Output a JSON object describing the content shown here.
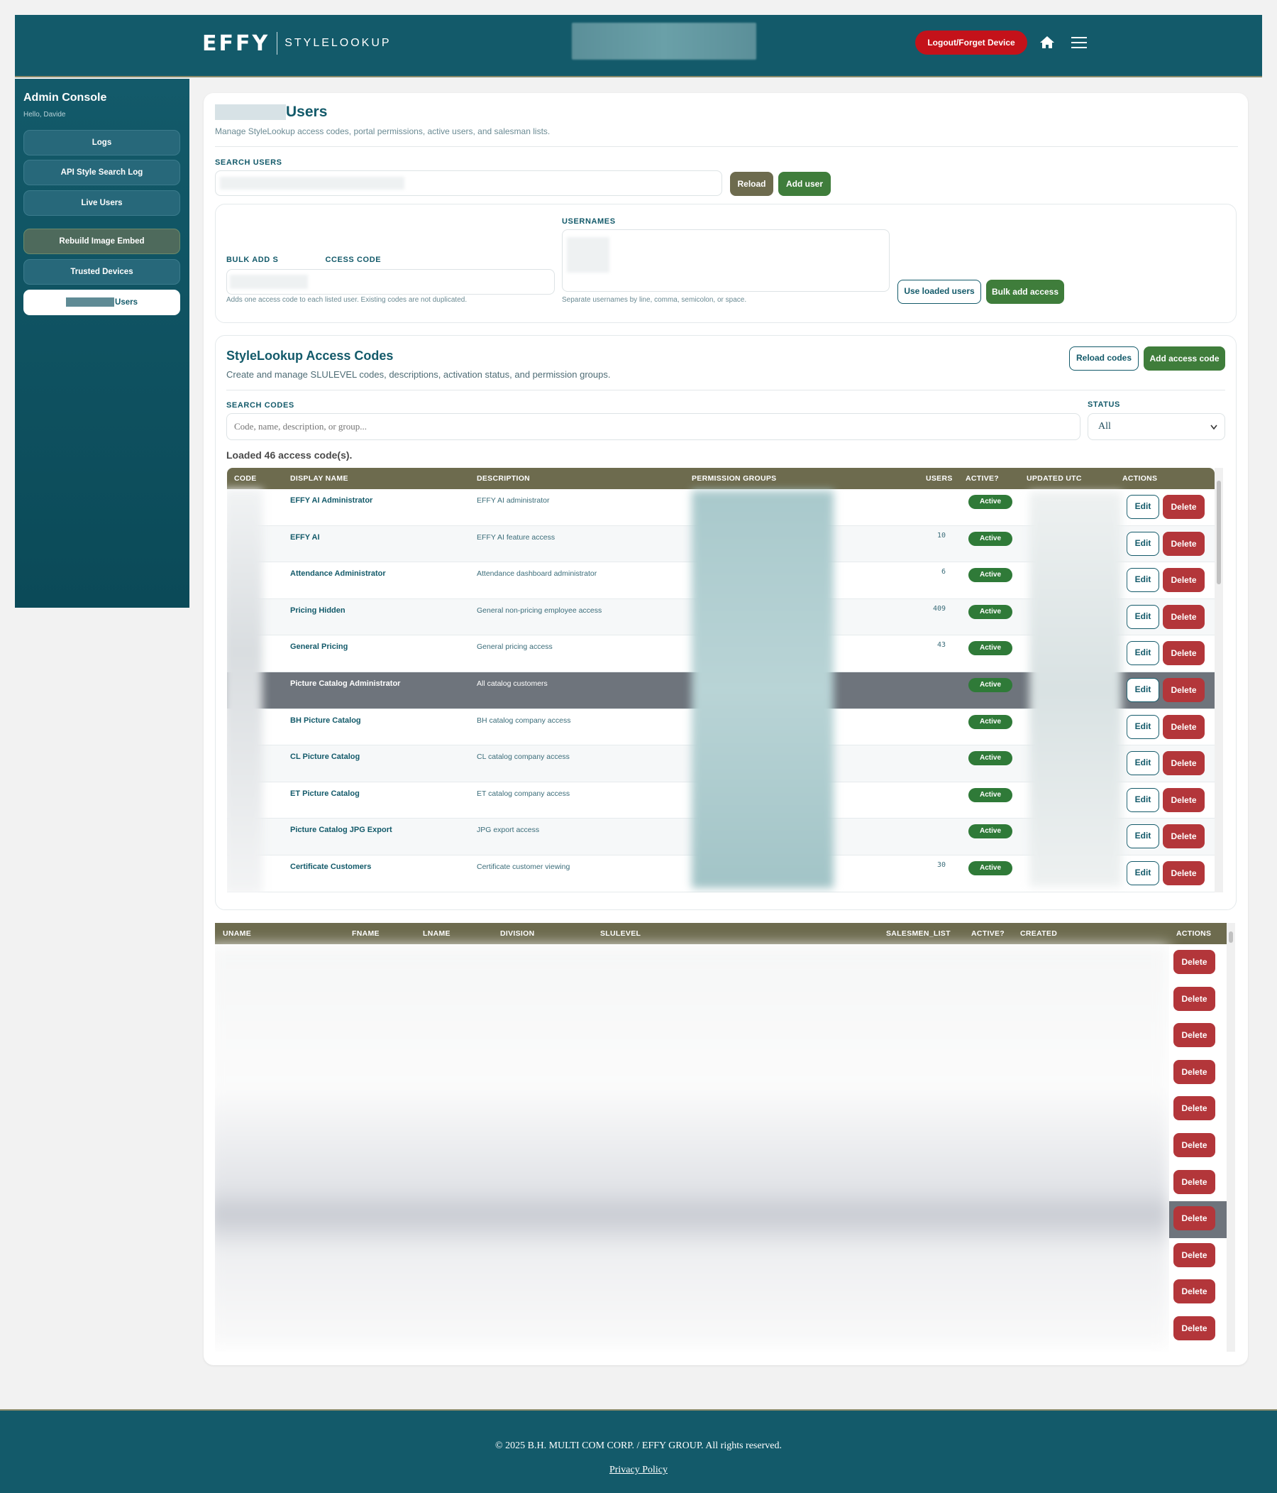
{
  "header": {
    "logo_mark": "EFFY",
    "logo_text": "STYLELOOKUP",
    "logout_label": "Logout/Forget Device"
  },
  "sidebar": {
    "title": "Admin Console",
    "greeting": "Hello, Davide",
    "items": [
      {
        "label": "Logs"
      },
      {
        "label": "API Style Search Log"
      },
      {
        "label": "Live Users"
      },
      {
        "label": "Rebuild Image Embed"
      },
      {
        "label": "Trusted Devices"
      },
      {
        "label": "Users"
      }
    ]
  },
  "page": {
    "title": "Users",
    "subtitle": "Manage StyleLookup access codes, portal permissions, active users, and salesman lists."
  },
  "search_users": {
    "label": "SEARCH USERS",
    "reload_label": "Reload",
    "add_user_label": "Add user"
  },
  "bulk": {
    "code_label_a": "BULK ADD S",
    "code_label_b": "CCESS CODE",
    "code_hint": "Adds one access code to each listed user. Existing codes are not duplicated.",
    "usernames_label": "USERNAMES",
    "usernames_hint": "Separate usernames by line, comma, semicolon, or space.",
    "use_loaded_label": "Use loaded users",
    "bulk_add_label": "Bulk add access"
  },
  "access_codes": {
    "title": "StyleLookup Access Codes",
    "subtitle": "Create and manage SLULEVEL codes, descriptions, activation status, and permission groups.",
    "reload_label": "Reload codes",
    "add_label": "Add access code",
    "search_label": "SEARCH CODES",
    "search_placeholder": "Code, name, description, or group...",
    "status_label": "STATUS",
    "status_value": "All",
    "loaded_text": "Loaded 46 access code(s).",
    "columns": [
      "CODE",
      "DISPLAY NAME",
      "DESCRIPTION",
      "PERMISSION GROUPS",
      "USERS",
      "ACTIVE?",
      "UPDATED UTC",
      "ACTIONS"
    ],
    "rows": [
      {
        "name": "EFFY AI Administrator",
        "desc": "EFFY AI administrator",
        "users": "",
        "active": "Active"
      },
      {
        "name": "EFFY AI",
        "desc": "EFFY AI feature access",
        "users": "10",
        "active": "Active"
      },
      {
        "name": "Attendance Administrator",
        "desc": "Attendance dashboard administrator",
        "users": "6",
        "active": "Active"
      },
      {
        "name": "Pricing Hidden",
        "desc": "General non-pricing employee access",
        "users": "409",
        "active": "Active"
      },
      {
        "name": "General Pricing",
        "desc": "General pricing access",
        "users": "43",
        "active": "Active"
      },
      {
        "name": "Picture Catalog Administrator",
        "desc": "All catalog customers",
        "users": "",
        "active": "Active"
      },
      {
        "name": "BH Picture Catalog",
        "desc": "BH catalog company access",
        "users": "",
        "active": "Active"
      },
      {
        "name": "CL Picture Catalog",
        "desc": "CL catalog company access",
        "users": "",
        "active": "Active"
      },
      {
        "name": "ET Picture Catalog",
        "desc": "ET catalog company access",
        "users": "",
        "active": "Active"
      },
      {
        "name": "Picture Catalog JPG Export",
        "desc": "JPG export access",
        "users": "",
        "active": "Active"
      },
      {
        "name": "Certificate Customers",
        "desc": "Certificate customer viewing",
        "users": "30",
        "active": "Active"
      }
    ],
    "edit_label": "Edit",
    "delete_label": "Delete"
  },
  "users_table": {
    "columns": [
      "UNAME",
      "FNAME",
      "LNAME",
      "DIVISION",
      "SLULEVEL",
      "SALESMEN_LIST",
      "ACTIVE?",
      "CREATED",
      "ACTIONS"
    ],
    "delete_label": "Delete"
  },
  "footer": {
    "copyright": "© 2025 B.H. MULTI COM CORP. / EFFY GROUP. All rights reserved.",
    "privacy_label": "Privacy Policy"
  }
}
